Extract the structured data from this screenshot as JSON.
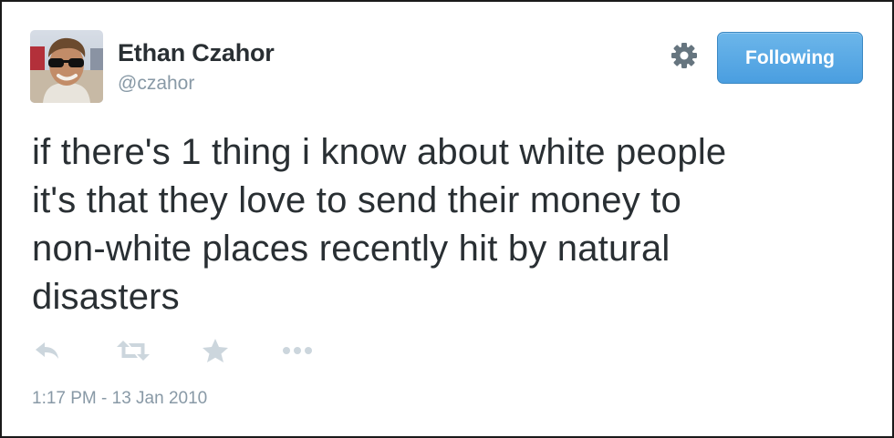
{
  "tweet": {
    "author": {
      "name": "Ethan Czahor",
      "handle": "@czahor",
      "avatar_icon": "profile-photo-sunglasses"
    },
    "follow_button_label": "Following",
    "settings_icon": "gear-icon",
    "text_lines": [
      "if there's 1 thing i know about white people",
      "it's that they love to send their money to",
      "non-white places recently hit by natural",
      "disasters"
    ],
    "actions": [
      "reply-icon",
      "retweet-icon",
      "favorite-star-icon",
      "more-dots-icon"
    ],
    "timestamp": "1:17 PM - 13 Jan 2010"
  },
  "colors": {
    "follow_button": "#55acee",
    "text": "#292f33",
    "muted": "#8899a6",
    "action_icons": "#ccd6dd"
  }
}
